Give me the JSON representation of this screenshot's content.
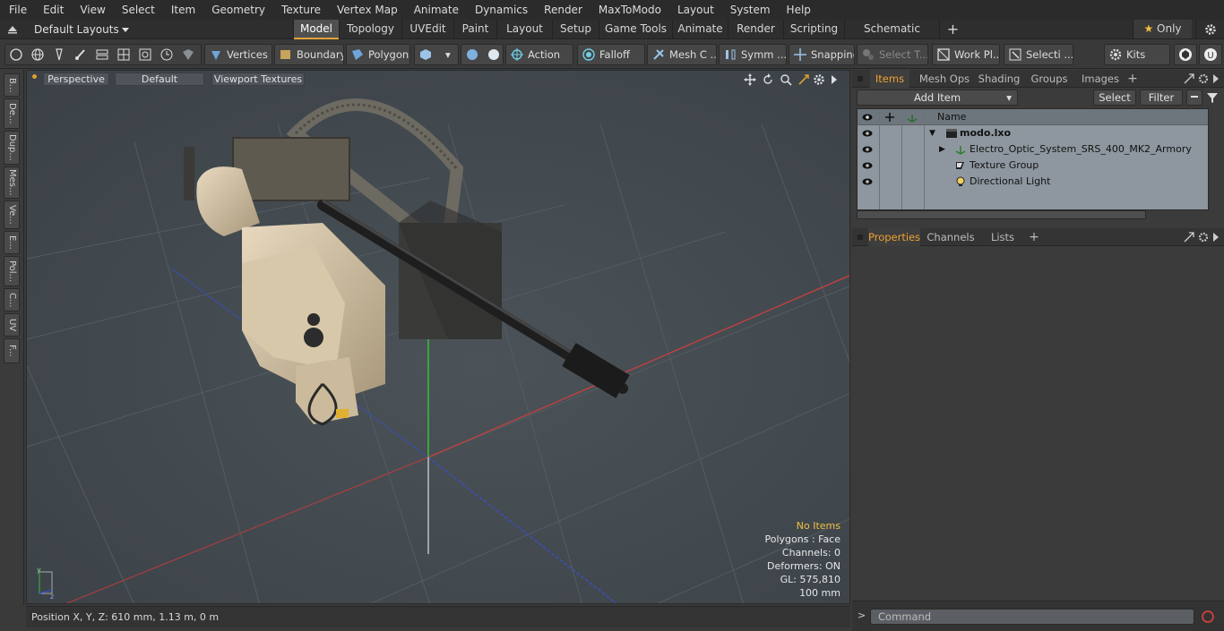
{
  "menu": [
    "File",
    "Edit",
    "View",
    "Select",
    "Item",
    "Geometry",
    "Texture",
    "Vertex Map",
    "Animate",
    "Dynamics",
    "Render",
    "MaxToModo",
    "Layout",
    "System",
    "Help"
  ],
  "layouts": {
    "label": "Default Layouts"
  },
  "tabs": [
    {
      "label": "Model",
      "active": true
    },
    {
      "label": "Topology"
    },
    {
      "label": "UVEdit"
    },
    {
      "label": "Paint"
    },
    {
      "label": "Layout"
    },
    {
      "label": "Setup"
    },
    {
      "label": "Game Tools"
    },
    {
      "label": "Animate"
    },
    {
      "label": "Render"
    },
    {
      "label": "Scripting"
    },
    {
      "label": "Schematic Fusion"
    }
  ],
  "only_label": "Only",
  "toolbar": {
    "vertices": "Vertices",
    "boundary": "Boundary",
    "polygons": "Polygons",
    "action": "Action",
    "falloff": "Falloff",
    "mesh": "Mesh C ...",
    "symm": "Symm ...",
    "snapping": "Snapping",
    "select_t": "Select T...",
    "work_pl": "Work Pl...",
    "selecti": "Selecti ...",
    "kits": "Kits"
  },
  "left_tabs": [
    "B...",
    "De...",
    "Dup...",
    "Mes...",
    "Ve...",
    "E...",
    "Pol...",
    "C...",
    "UV",
    "F..."
  ],
  "viewport": {
    "perspective": "Perspective",
    "default": "Default",
    "textures": "Viewport Textures",
    "info": {
      "no_items": "No Items",
      "polygons": "Polygons : Face",
      "channels": "Channels: 0",
      "deformers": "Deformers: ON",
      "gl": "GL: 575,810",
      "scale": "100 mm"
    }
  },
  "status": "Position X, Y, Z:   610 mm, 1.13 m, 0 m",
  "items_panel": {
    "tabs": [
      "Items",
      "Mesh Ops",
      "Shading",
      "Groups",
      "Images"
    ],
    "add_item": "Add Item",
    "select": "Select",
    "filter": "Filter",
    "name_col": "Name",
    "rows": [
      {
        "label": "modo.lxo",
        "bold": true
      },
      {
        "label": "Electro_Optic_System_SRS_400_MK2_Armory"
      },
      {
        "label": "Texture Group"
      },
      {
        "label": "Directional Light"
      }
    ]
  },
  "props_panel": {
    "tabs": [
      "Properties",
      "Channels",
      "Lists"
    ]
  },
  "command": {
    "placeholder": "Command"
  },
  "colors": {
    "accent": "#f0a030",
    "axis_x": "#d03030",
    "axis_y": "#30c030",
    "axis_z": "#3050d0"
  }
}
